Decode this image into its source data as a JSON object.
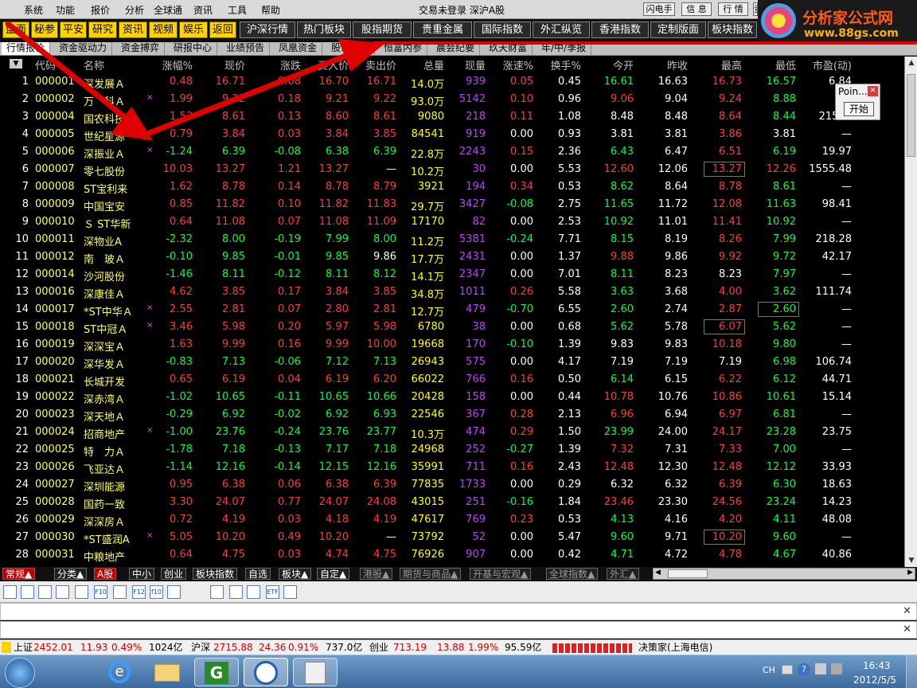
{
  "menu": {
    "items": [
      "系统",
      "功能",
      "报价",
      "分析",
      "全球通",
      "资讯",
      "工具",
      "帮助"
    ],
    "title": "交易未登录  深沪A股",
    "right_buttons": [
      "闪电手",
      "信 息",
      "行 情",
      "资 讯"
    ]
  },
  "toolbar": {
    "yellow": [
      "盘面",
      "秘参",
      "平安",
      "研究",
      "资讯",
      "视频",
      "娱乐",
      "返回"
    ],
    "gray": [
      "沪深行情",
      "热门板块",
      "股指期货",
      "贵重金属",
      "国际指数",
      "外汇纵览",
      "香港指数",
      "定制版面",
      "板块指数"
    ]
  },
  "logo": {
    "name": "分析家公式网",
    "url": "www.88gs.com"
  },
  "subtabs": [
    "行情报价",
    "资金驱动力",
    "资金搏弈",
    "研报中心",
    "业绩预告",
    "凤凰资金",
    "股市要闻",
    "恒富内参",
    "晨会纪要",
    "玖天财富",
    "年/中/季报"
  ],
  "table": {
    "headers": [
      "",
      "代码",
      "名称",
      "",
      "涨幅%",
      "现价",
      "涨跌",
      "买入价",
      "卖出价",
      "总量",
      "现量",
      "涨速%",
      "换手%",
      "今开",
      "昨收",
      "最高",
      "最低",
      "市盈(动)"
    ],
    "rows": [
      [
        "1",
        "000001",
        "深发展Ａ",
        "",
        "0.48",
        "16.71",
        "0.08",
        "16.70",
        "16.71",
        "14.0万",
        "939",
        "0.05",
        "0.45",
        "16.61",
        "16.63",
        "16.73",
        "16.57",
        "6.84"
      ],
      [
        "2",
        "000002",
        "万　科Ａ",
        "×",
        "1.99",
        "9.22",
        "0.18",
        "9.21",
        "9.22",
        "93.0万",
        "5142",
        "0.10",
        "0.96",
        "9.06",
        "9.04",
        "9.24",
        "8.88",
        "18"
      ],
      [
        "3",
        "000004",
        "国农科技",
        "",
        "1.53",
        "8.61",
        "0.13",
        "8.60",
        "8.61",
        "9080",
        "218",
        "0.11",
        "1.08",
        "8.48",
        "8.48",
        "8.64",
        "8.44",
        "21519"
      ],
      [
        "4",
        "000005",
        "世纪星源",
        "",
        "0.79",
        "3.84",
        "0.03",
        "3.84",
        "3.85",
        "84541",
        "919",
        "0.00",
        "0.93",
        "3.81",
        "3.81",
        "3.86",
        "3.81",
        "—"
      ],
      [
        "5",
        "000006",
        "深振业Ａ",
        "×",
        "-1.24",
        "6.39",
        "-0.08",
        "6.38",
        "6.39",
        "22.8万",
        "2243",
        "0.15",
        "2.36",
        "6.43",
        "6.47",
        "6.51",
        "6.19",
        "19.97"
      ],
      [
        "6",
        "000007",
        "零七股份",
        "",
        "10.03",
        "13.27",
        "1.21",
        "13.27",
        "—",
        "10.2万",
        "30",
        "0.00",
        "5.53",
        "12.60",
        "12.06",
        "13.27",
        "12.26",
        "1555.48"
      ],
      [
        "7",
        "000008",
        "ST宝利来",
        "",
        "1.62",
        "8.78",
        "0.14",
        "8.78",
        "8.79",
        "3921",
        "194",
        "0.34",
        "0.53",
        "8.62",
        "8.64",
        "8.78",
        "8.61",
        "—"
      ],
      [
        "8",
        "000009",
        "中国宝安",
        "",
        "0.85",
        "11.82",
        "0.10",
        "11.82",
        "11.83",
        "29.7万",
        "3427",
        "-0.08",
        "2.75",
        "11.65",
        "11.72",
        "12.08",
        "11.63",
        "98.41"
      ],
      [
        "9",
        "000010",
        "Ｓ ST华新",
        "",
        "0.64",
        "11.08",
        "0.07",
        "11.08",
        "11.09",
        "17170",
        "82",
        "0.00",
        "2.53",
        "10.92",
        "11.01",
        "11.41",
        "10.92",
        "—"
      ],
      [
        "10",
        "000011",
        "深物业A",
        "",
        "-2.32",
        "8.00",
        "-0.19",
        "7.99",
        "8.00",
        "11.2万",
        "5381",
        "-0.24",
        "7.71",
        "8.15",
        "8.19",
        "8.26",
        "7.99",
        "218.28"
      ],
      [
        "11",
        "000012",
        "南　玻Ａ",
        "",
        "-0.10",
        "9.85",
        "-0.01",
        "9.85",
        "9.86",
        "17.7万",
        "2431",
        "0.00",
        "1.37",
        "9.88",
        "9.86",
        "9.92",
        "9.72",
        "42.17"
      ],
      [
        "12",
        "000014",
        "沙河股份",
        "",
        "-1.46",
        "8.11",
        "-0.12",
        "8.11",
        "8.12",
        "14.1万",
        "2347",
        "0.00",
        "7.01",
        "8.11",
        "8.23",
        "8.23",
        "7.97",
        "—"
      ],
      [
        "13",
        "000016",
        "深康佳Ａ",
        "",
        "4.62",
        "3.85",
        "0.17",
        "3.84",
        "3.85",
        "34.8万",
        "1011",
        "0.26",
        "5.58",
        "3.63",
        "3.68",
        "4.00",
        "3.62",
        "111.74"
      ],
      [
        "14",
        "000017",
        "*ST中华Ａ",
        "×",
        "2.55",
        "2.81",
        "0.07",
        "2.80",
        "2.81",
        "12.7万",
        "479",
        "-0.70",
        "6.55",
        "2.60",
        "2.74",
        "2.87",
        "2.60",
        "—"
      ],
      [
        "15",
        "000018",
        "ST中冠Ａ",
        "×",
        "3.46",
        "5.98",
        "0.20",
        "5.97",
        "5.98",
        "6780",
        "38",
        "0.00",
        "0.68",
        "5.62",
        "5.78",
        "6.07",
        "5.62",
        "—"
      ],
      [
        "16",
        "000019",
        "深深宝Ａ",
        "",
        "1.63",
        "9.99",
        "0.16",
        "9.99",
        "10.00",
        "19668",
        "170",
        "-0.10",
        "1.39",
        "9.83",
        "9.83",
        "10.18",
        "9.80",
        "—"
      ],
      [
        "17",
        "000020",
        "深华发Ａ",
        "",
        "-0.83",
        "7.13",
        "-0.06",
        "7.12",
        "7.13",
        "26943",
        "575",
        "0.00",
        "4.17",
        "7.19",
        "7.19",
        "7.19",
        "6.98",
        "106.74"
      ],
      [
        "18",
        "000021",
        "长城开发",
        "",
        "0.65",
        "6.19",
        "0.04",
        "6.19",
        "6.20",
        "66022",
        "766",
        "0.16",
        "0.50",
        "6.14",
        "6.15",
        "6.22",
        "6.12",
        "44.71"
      ],
      [
        "19",
        "000022",
        "深赤湾Ａ",
        "",
        "-1.02",
        "10.65",
        "-0.11",
        "10.65",
        "10.66",
        "20428",
        "158",
        "0.00",
        "0.44",
        "10.78",
        "10.76",
        "10.86",
        "10.61",
        "15.14"
      ],
      [
        "20",
        "000023",
        "深天地Ａ",
        "",
        "-0.29",
        "6.92",
        "-0.02",
        "6.92",
        "6.93",
        "22546",
        "367",
        "0.28",
        "2.13",
        "6.96",
        "6.94",
        "6.97",
        "6.81",
        "—"
      ],
      [
        "21",
        "000024",
        "招商地产",
        "×",
        "-1.00",
        "23.76",
        "-0.24",
        "23.76",
        "23.77",
        "10.3万",
        "474",
        "0.29",
        "1.50",
        "23.99",
        "24.00",
        "24.17",
        "23.28",
        "23.75"
      ],
      [
        "22",
        "000025",
        "特　力Ａ",
        "",
        "-1.78",
        "7.18",
        "-0.13",
        "7.17",
        "7.18",
        "24968",
        "252",
        "-0.27",
        "1.39",
        "7.32",
        "7.31",
        "7.33",
        "7.00",
        "—"
      ],
      [
        "23",
        "000026",
        "飞亚达Ａ",
        "",
        "-1.14",
        "12.16",
        "-0.14",
        "12.15",
        "12.16",
        "35991",
        "711",
        "0.16",
        "2.43",
        "12.48",
        "12.30",
        "12.48",
        "12.12",
        "33.93"
      ],
      [
        "24",
        "000027",
        "深圳能源",
        "",
        "0.95",
        "6.38",
        "0.06",
        "6.38",
        "6.39",
        "77835",
        "1733",
        "0.00",
        "0.29",
        "6.32",
        "6.32",
        "6.39",
        "6.30",
        "18.63"
      ],
      [
        "25",
        "000028",
        "国药一致",
        "",
        "3.30",
        "24.07",
        "0.77",
        "24.07",
        "24.08",
        "43015",
        "251",
        "-0.16",
        "1.84",
        "23.46",
        "23.30",
        "24.56",
        "23.24",
        "14.23"
      ],
      [
        "26",
        "000029",
        "深深房Ａ",
        "",
        "0.72",
        "4.19",
        "0.03",
        "4.18",
        "4.19",
        "47617",
        "769",
        "0.23",
        "0.53",
        "4.13",
        "4.16",
        "4.20",
        "4.11",
        "48.08"
      ],
      [
        "27",
        "000030",
        "*ST盛润A",
        "×",
        "5.05",
        "10.20",
        "0.49",
        "10.20",
        "—",
        "73792",
        "52",
        "0.00",
        "5.47",
        "9.60",
        "9.71",
        "10.20",
        "9.60",
        "—"
      ],
      [
        "28",
        "000031",
        "中粮地产",
        "",
        "0.64",
        "4.75",
        "0.03",
        "4.74",
        "4.75",
        "76926",
        "907",
        "0.00",
        "0.42",
        "4.71",
        "4.72",
        "4.78",
        "4.67",
        "40.86"
      ]
    ]
  },
  "bottom_tabs": [
    "常规▲",
    "分类▲",
    "A股",
    "中小",
    "创业",
    "板块指数",
    "自选",
    "板块▲",
    "自定▲",
    "港股▲",
    "期货与商品▲",
    "开基与宏观▲",
    "全球指数▲",
    "外汇▲"
  ],
  "icons": [
    "table-icon",
    "grid-icon",
    "chart-icon",
    "stack-icon",
    "list-icon",
    "f10-icon",
    "doc-icon",
    "f12-icon",
    "f10w-icon",
    "sum-icon",
    "folder-icon",
    "arrows-icon",
    "target-icon",
    "etf-icon",
    "export-icon"
  ],
  "icon_labels": [
    "",
    "",
    "",
    "",
    "",
    "F10",
    "",
    "F12",
    "f10",
    "",
    "",
    "",
    "",
    "ETF",
    ""
  ],
  "index_bar": {
    "sh_label": "上证",
    "sh_val": "2452.01",
    "sh_chg": "11.93",
    "sh_pct": "0.49%",
    "sh_amt": "1024亿",
    "sz_label": "沪深",
    "sz_val": "2715.88",
    "sz_chg": "24.36",
    "sz_pct": "0.91%",
    "sz_amt": "737.0亿",
    "cy_label": "创业",
    "cy_val": "713.19",
    "cy_chg": "13.88",
    "cy_pct": "1.99%",
    "cy_amt": "95.59亿",
    "broker": "决策家(上海电信)"
  },
  "popup": {
    "title": "Poin...",
    "button": "开始"
  },
  "taskbar": {
    "lang": "CH",
    "time": "16:43",
    "date": "2012/5/5"
  },
  "colors": {
    "up": "#ff3c3c",
    "down": "#00ff3c",
    "flat": "#ffffff",
    "code": "#ffff5a",
    "name": "#ffff5a",
    "volume": "#ffff00",
    "curvol": "#c040ff",
    "header": "#c0c0c0",
    "arrow": "#e00000"
  }
}
